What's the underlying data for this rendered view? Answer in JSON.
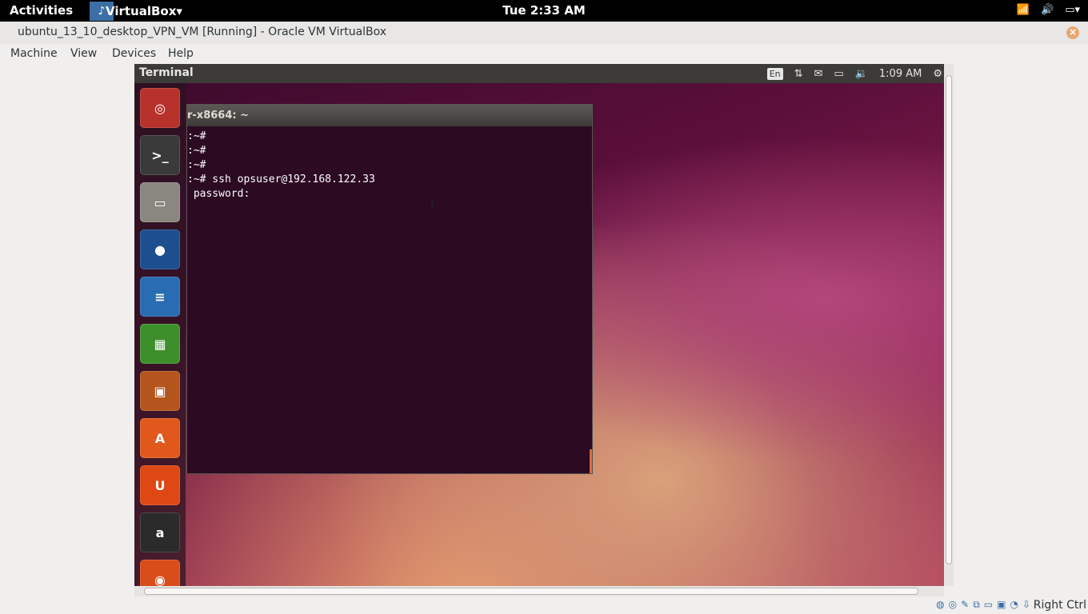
{
  "top_bar": {
    "activities": "Activities",
    "app_name": "VirtualBox",
    "app_arrow": "▾",
    "clock": "Tue  2:33 AM"
  },
  "window": {
    "title": "ubuntu_13_10_desktop_VPN_VM [Running] - Oracle VM VirtualBox",
    "close_glyph": "×"
  },
  "menu": {
    "items": [
      "Machine",
      "View",
      "Devices",
      "Help"
    ]
  },
  "guest": {
    "panel_title": "Terminal",
    "keyboard": "En",
    "clock": "1:09 AM",
    "terminal": {
      "title": "r-x8664: ~",
      "lines": [
        ":~#",
        ":~#",
        ":~#",
        ":~# ssh opsuser@192.168.122.33",
        " password:"
      ]
    },
    "launcher_icons": [
      "ubuntu-logo",
      "terminal",
      "files",
      "firefox",
      "writer",
      "calc",
      "impress",
      "software-center",
      "ubuntu-one",
      "amazon",
      "rhythmbox"
    ]
  },
  "status_bar": {
    "host_key": "Right Ctrl"
  }
}
